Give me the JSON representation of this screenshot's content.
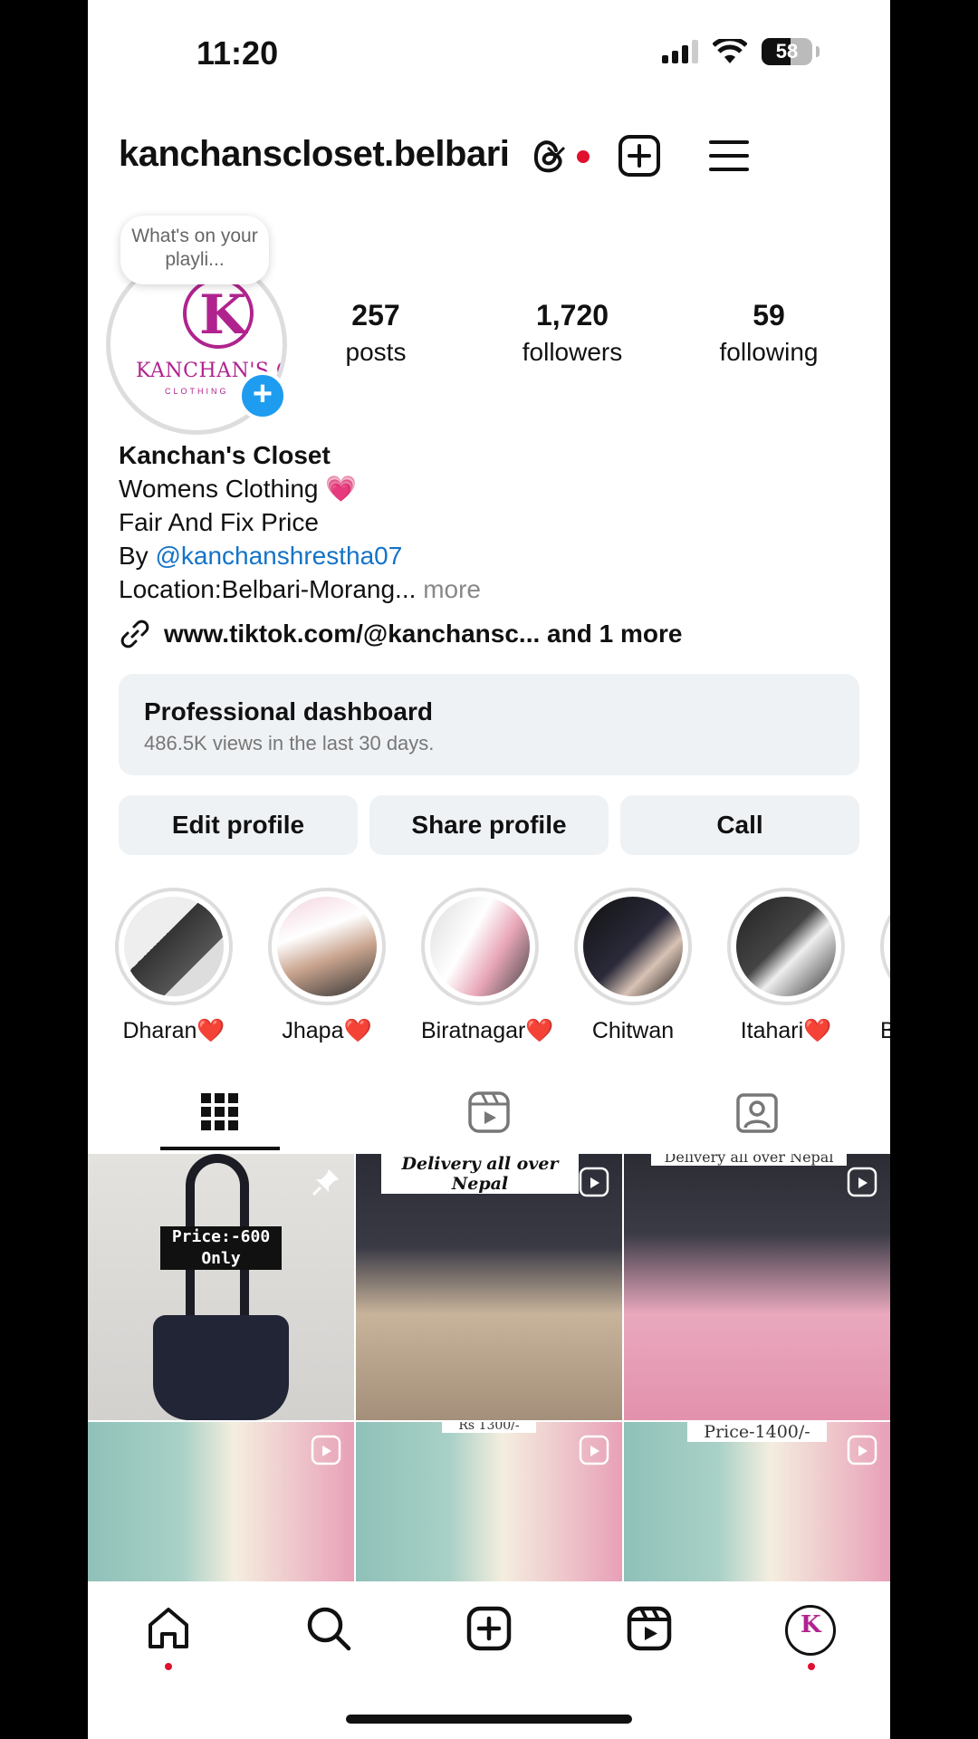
{
  "status_bar": {
    "time": "11:20",
    "battery": "58"
  },
  "header": {
    "username": "kanchanscloset.belbari"
  },
  "profile": {
    "note": "What's on your playli...",
    "logo_text": "KANCHAN'S CL",
    "logo_sub": "CLOTHING",
    "stats": [
      {
        "value": "257",
        "label": "posts"
      },
      {
        "value": "1,720",
        "label": "followers"
      },
      {
        "value": "59",
        "label": "following"
      }
    ],
    "name": "Kanchan's Closet",
    "bio_line1": "Womens Clothing 💗",
    "bio_line2": "Fair And Fix Price",
    "bio_by": "By ",
    "bio_mention": "@kanchanshrestha07",
    "bio_location": "Location:Belbari-Morang... ",
    "bio_more": "more",
    "link_text": "www.tiktok.com/@kanchansc...  and 1 more"
  },
  "dashboard": {
    "title": "Professional dashboard",
    "subtitle": "486.5K views in the last 30 days."
  },
  "buttons": {
    "edit": "Edit profile",
    "share": "Share profile",
    "call": "Call"
  },
  "highlights": [
    {
      "label": "Dharan❤️"
    },
    {
      "label": "Jhapa❤️"
    },
    {
      "label": "Biratnagar❤️"
    },
    {
      "label": "Chitwan"
    },
    {
      "label": "Itahari❤️"
    },
    {
      "label": "B"
    }
  ],
  "posts": {
    "tile1_caption": "Price:-600 Only",
    "tile2_caption": "Delivery all over Nepal",
    "tile3_caption": "Delivery all over Nepal",
    "tile5_caption": "Rs 1300/-",
    "tile6_caption": "Price-1400/-"
  },
  "colors": {
    "accent_blue": "#1e9cf0",
    "brand_magenta": "#b0238e",
    "notification_red": "#e0102e"
  }
}
